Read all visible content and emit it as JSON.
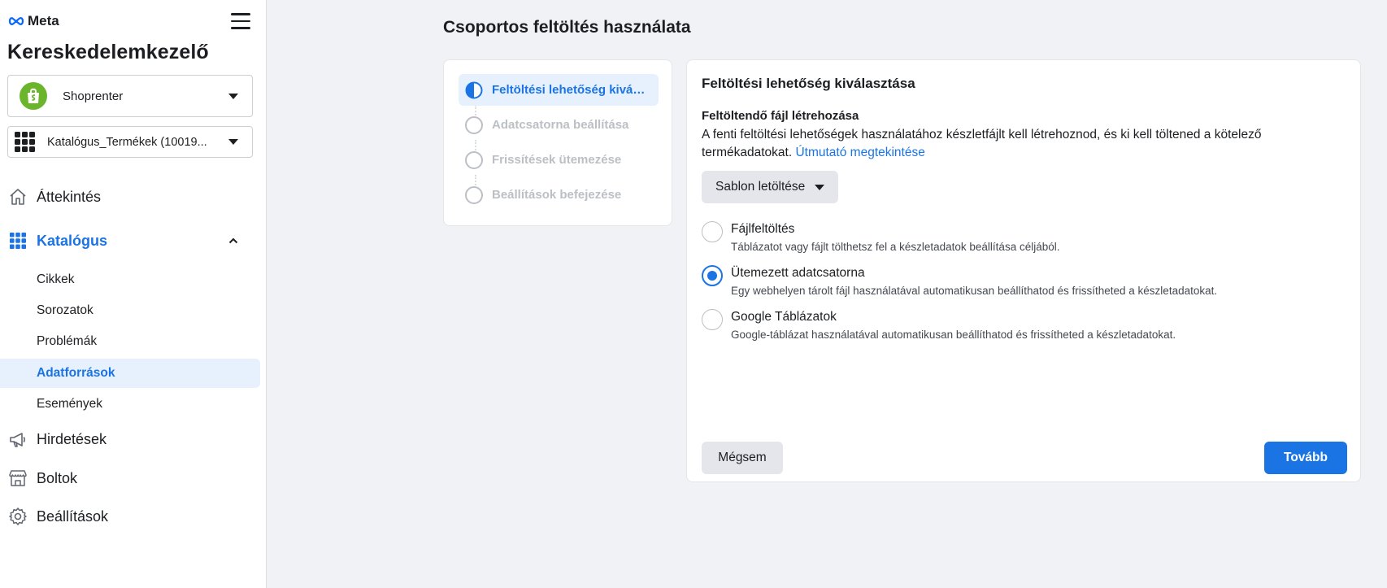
{
  "brand": {
    "logo_text": "Meta"
  },
  "app": {
    "title": "Kereskedelemkezelő"
  },
  "business_selector": {
    "value": "Shoprenter"
  },
  "catalog_selector": {
    "value": "Katalógus_Termékek (10019..."
  },
  "sidebar": {
    "overview": "Áttekintés",
    "catalog": "Katalógus",
    "catalog_items": [
      "Cikkek",
      "Sorozatok",
      "Problémák",
      "Adatforrások",
      "Események"
    ],
    "active_catalog_item": "Adatforrások",
    "ads": "Hirdetések",
    "shops": "Boltok",
    "settings": "Beállítások"
  },
  "main": {
    "page_title": "Csoportos feltöltés használata",
    "steps": [
      {
        "label": "Feltöltési lehetőség kiválasztása",
        "state": "active"
      },
      {
        "label": "Adatcsatorna beállítása",
        "state": "pending"
      },
      {
        "label": "Frissítések ütemezése",
        "state": "pending"
      },
      {
        "label": "Beállítások befejezése",
        "state": "pending"
      }
    ],
    "card": {
      "title": "Feltöltési lehetőség kiválasztása",
      "section_title": "Feltöltendő fájl létrehozása",
      "section_desc": "A fenti feltöltési lehetőségek használatához készletfájlt kell létrehoznod, és ki kell töltened a kötelező termékadatokat.",
      "guide_link": "Útmutató megtekintése",
      "template_button": "Sablon letöltése",
      "options": [
        {
          "title": "Fájlfeltöltés",
          "desc": "Táblázatot vagy fájlt tölthetsz fel a készletadatok beállítása céljából.",
          "selected": false
        },
        {
          "title": "Ütemezett adatcsatorna",
          "desc": "Egy webhelyen tárolt fájl használatával automatikusan beállíthatod és frissítheted a készletadatokat.",
          "selected": true
        },
        {
          "title": "Google Táblázatok",
          "desc": "Google-táblázat használatával automatikusan beállíthatod és frissítheted a készletadatokat.",
          "selected": false
        }
      ],
      "cancel_button": "Mégsem",
      "next_button": "Tovább"
    }
  },
  "colors": {
    "accent": "#1b74e4",
    "active_bg": "#e7f0fd",
    "shop_logo": "#6bb52c"
  }
}
